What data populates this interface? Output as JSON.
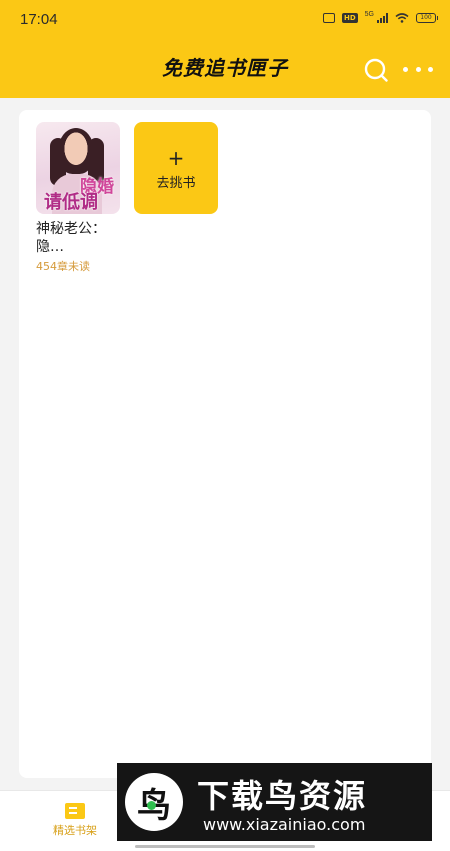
{
  "status_bar": {
    "time": "17:04",
    "hd_badge": "HD",
    "network": "5G",
    "battery": "100"
  },
  "header": {
    "title": "免费追书匣子",
    "search_icon": "search-icon",
    "more_icon": "more-dots-icon",
    "background": "#fbc815"
  },
  "shelf": {
    "books": [
      {
        "cover_text_1": "隐婚",
        "cover_text_2": "请低调",
        "title": "神秘老公：隐…",
        "unread": "454章未读"
      }
    ],
    "add_tile": {
      "plus": "+",
      "label": "去挑书"
    }
  },
  "bottom_nav": {
    "tabs": [
      {
        "label": "精选书架",
        "icon": "bookshelf-icon",
        "active": true
      }
    ]
  },
  "watermark": {
    "logo_char": "鸟",
    "name": "下载鸟资源",
    "url": "www.xiazainiao.com"
  },
  "colors": {
    "accent": "#fbc815",
    "unread": "#d59a3a"
  }
}
